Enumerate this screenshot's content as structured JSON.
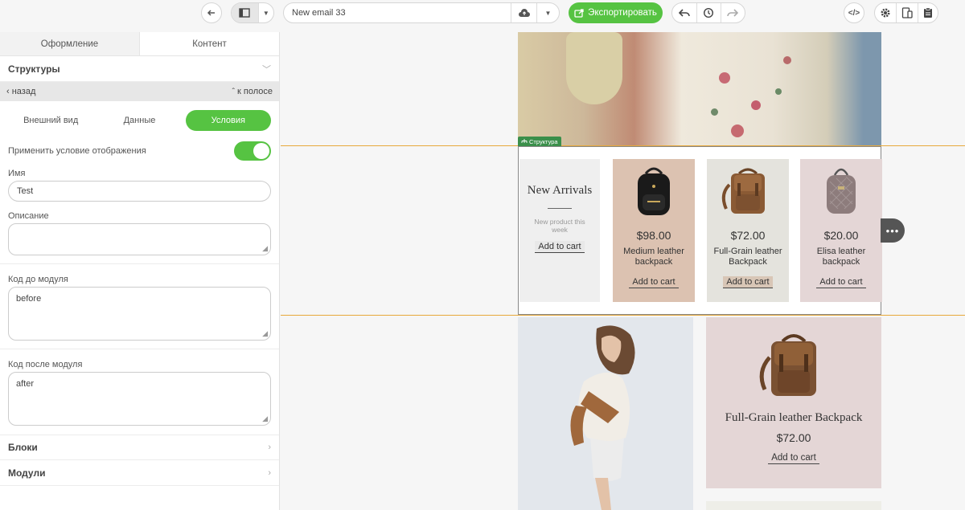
{
  "toolbar": {
    "email_title": "New email 33",
    "export_label": "Экспортировать"
  },
  "panel": {
    "tabs": {
      "design": "Оформление",
      "content": "Контент"
    },
    "structures": "Структуры",
    "back": "назад",
    "to_strip": "к полосе",
    "subtabs": {
      "appearance": "Внешний вид",
      "data": "Данные",
      "conditions": "Условия"
    },
    "apply_condition": "Применить условие отображения",
    "name_label": "Имя",
    "name_value": "Test",
    "description_label": "Описание",
    "description_value": "",
    "code_before_label": "Код до модуля",
    "code_before_value": "before",
    "code_after_label": "Код после модуля",
    "code_after_value": "after",
    "blocks": "Блоки",
    "modules": "Модули"
  },
  "canvas": {
    "structure_tag": "Структура",
    "intro": {
      "heading": "New Arrivals",
      "subtitle": "New product this week",
      "cart": "Add to cart"
    },
    "products": [
      {
        "price": "$98.00",
        "name": "Medium leather backpack",
        "cart": "Add to cart",
        "color": "#dcc2b1"
      },
      {
        "price": "$72.00",
        "name": "Full-Grain leather Backpack",
        "cart": "Add to cart",
        "color": "#e4e3dd"
      },
      {
        "price": "$20.00",
        "name": "Elisa leather backpack",
        "cart": "Add to cart",
        "color": "#e4d6d6"
      }
    ],
    "featured": {
      "name": "Full-Grain leather Backpack",
      "price": "$72.00",
      "cart": "Add to cart"
    }
  },
  "colors": {
    "accent": "#56c342",
    "guide": "#e7a93b"
  }
}
